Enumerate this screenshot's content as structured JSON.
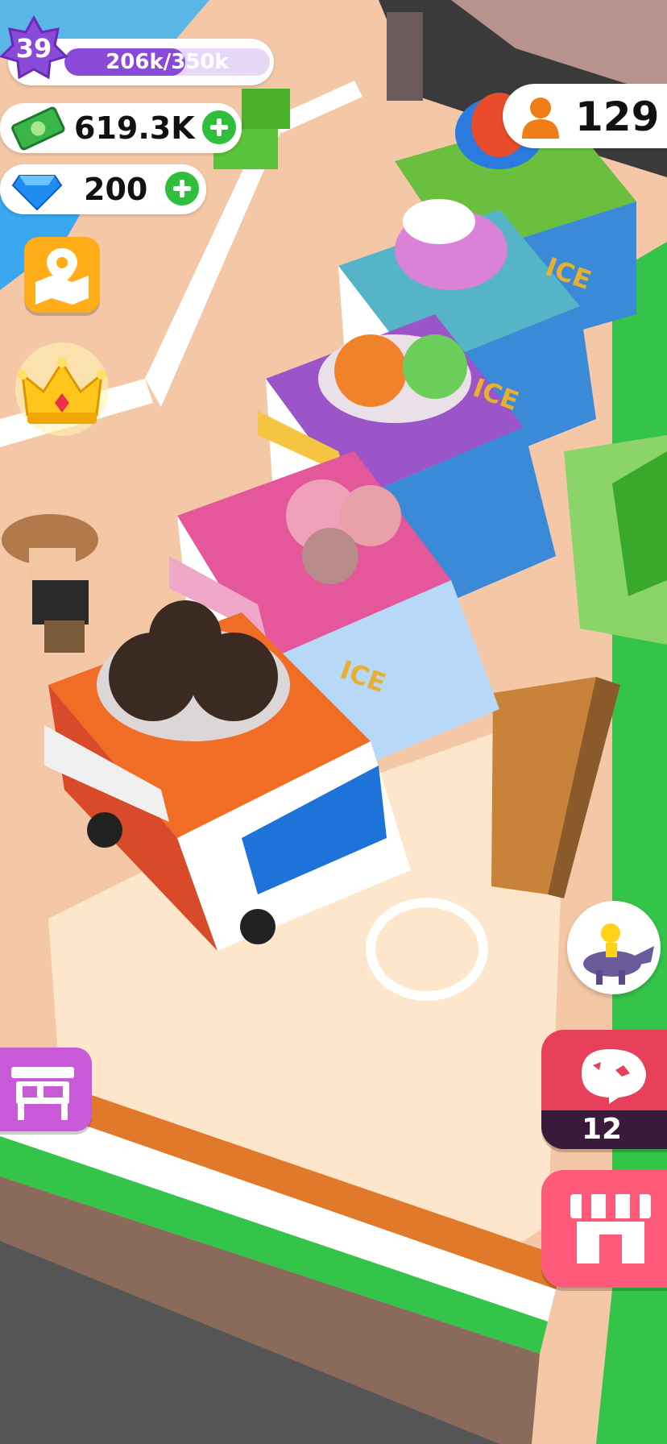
{
  "hud": {
    "level": "39",
    "xp_text": "206k/350k",
    "xp_progress": 0.59,
    "cash": "619.3K",
    "gems": "200",
    "visitors": "129"
  },
  "trucks": [
    {
      "sign": "ICE",
      "color": "#6bbf3f",
      "food": "ice-cream-blue-red"
    },
    {
      "sign": "ICE",
      "color": "#55b4c8",
      "food": "ice-cream-pink-purple"
    },
    {
      "sign": "ICE",
      "color": "#9b55c9",
      "food": "macarons-orange-green"
    },
    {
      "sign": "ICE",
      "color": "#e4579a",
      "food": "ice-cream-cone-pink"
    },
    {
      "sign": "ICE",
      "color": "#f06d26",
      "food": "chocolate-donuts"
    }
  ],
  "buttons": {
    "dino_count": "12"
  },
  "icons": {
    "level": "star-badge-icon",
    "cash": "cash-icon",
    "gems": "diamond-icon",
    "visitors": "person-icon",
    "map": "map-pin-icon",
    "crown": "crown-icon",
    "stall": "stall-icon",
    "dino": "dino-icon",
    "shop": "shop-icon"
  },
  "colors": {
    "xp_bar": "#8a4ad8",
    "plus": "#2fbf3c",
    "map_button": "#ffae1a",
    "stall_button": "#c85ad8",
    "dino_button": "#e8405a",
    "shop_button": "#ff5a7a"
  }
}
